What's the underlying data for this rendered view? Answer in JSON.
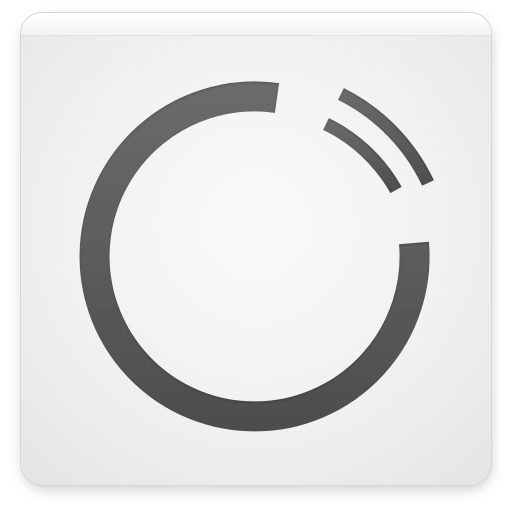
{
  "app_icon": {
    "name": "circular-arc-app-icon",
    "colors": {
      "tile": "#f1f1f1",
      "tile_edge": "#d6d6d6",
      "arc": "#555555",
      "arc_highlight": "#6a6a6a"
    }
  }
}
